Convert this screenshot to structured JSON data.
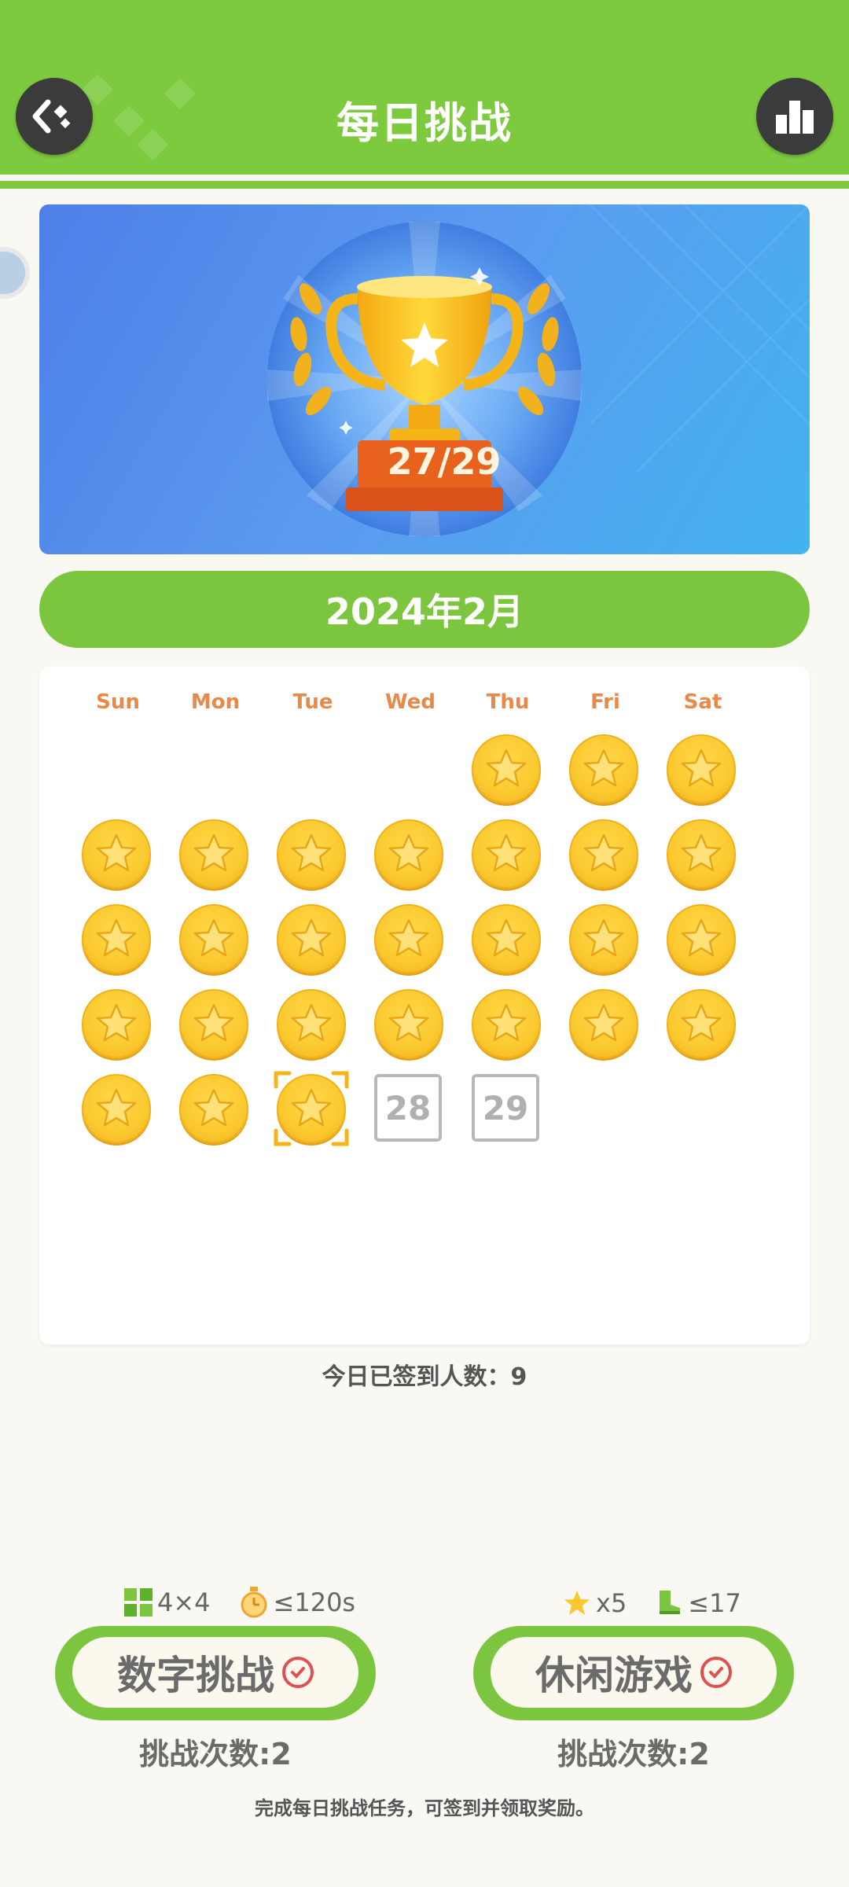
{
  "header": {
    "title": "每日挑战",
    "back_icon": "back-arrow-icon",
    "rank_icon": "podium-icon",
    "color": "#7dca3f"
  },
  "banner": {
    "trophy_count": "27/29"
  },
  "calendar": {
    "month": "2024年2月",
    "weekdays": [
      "Sun",
      "Mon",
      "Tue",
      "Wed",
      "Thu",
      "Fri",
      "Sat"
    ],
    "first_weekday": 4,
    "days_in_month": 29,
    "completed_through": 27,
    "today": 27,
    "pending_days": [
      "28",
      "29"
    ],
    "checkin_text": "今日已签到人数：9"
  },
  "challenges": [
    {
      "label": "数字挑战",
      "req_1": "4×4",
      "req_2": "≤120s",
      "tries": "挑战次数:2",
      "done": true
    },
    {
      "label": "休闲游戏",
      "req_1": "x5",
      "req_2": "≤17",
      "tries": "挑战次数:2",
      "done": true
    }
  ],
  "footer_note": "完成每日挑战任务，可签到并领取奖励。",
  "colors": {
    "green": "#7cc63f",
    "gold": "#fbc92f",
    "weekday": "#e8894a",
    "check_red": "#e05050"
  }
}
